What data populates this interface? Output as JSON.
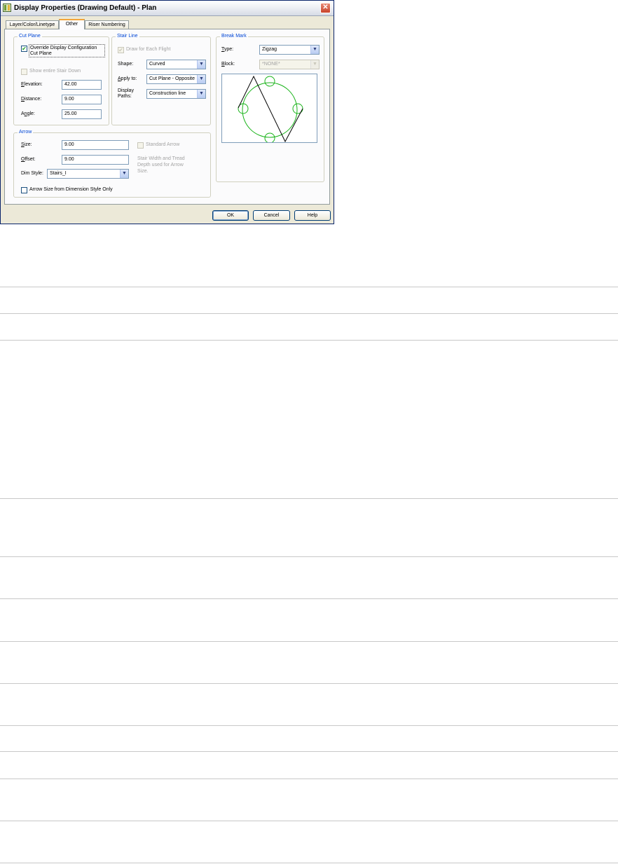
{
  "window": {
    "title": "Display Properties (Drawing Default) - Plan",
    "close_glyph": "✕"
  },
  "tabs": [
    {
      "label": "Layer/Color/Linetype",
      "active": false
    },
    {
      "label": "Other",
      "active": true
    },
    {
      "label": "Riser Numbering",
      "active": false
    }
  ],
  "cut_plane": {
    "legend": "Cut Plane",
    "override_label_line1": "Override Display Configuration",
    "override_label_line2": "Cut Plane",
    "override_checked": true,
    "show_entire_label": "Show entire Stair Down",
    "show_entire_checked": false,
    "elevation_label": "Elevation:",
    "elevation_value": "42.00",
    "distance_label": "Distance:",
    "distance_value": "9.00",
    "angle_label": "Angle:",
    "angle_value": "25.00"
  },
  "stair_line": {
    "legend": "Stair Line",
    "draw_each_label": "Draw for Each Flight",
    "draw_each_checked": true,
    "shape_label": "Shape:",
    "shape_value": "Curved",
    "apply_to_label": "Apply to:",
    "apply_to_value": "Cut Plane - Opposite",
    "display_paths_label_line1": "Display",
    "display_paths_label_line2": "Paths:",
    "display_paths_value": "Construction line"
  },
  "break_mark": {
    "legend": "Break Mark",
    "type_label": "Type:",
    "type_value": "Zigzag",
    "block_label": "Block:",
    "block_value": "*NONE*"
  },
  "arrow": {
    "legend": "Arrow",
    "size_label": "Size:",
    "size_value": "9.00",
    "offset_label": "Offset:",
    "offset_value": "9.00",
    "dim_style_label": "Dim Style:",
    "dim_style_value": "Stairs_I",
    "standard_arrow_label": "Standard Arrow",
    "standard_arrow_checked": false,
    "note_line1": "Stair Width and Tread",
    "note_line2": "Depth used for Arrow",
    "note_line3": "Size.",
    "arrow_size_from_dim_label": "Arrow Size from Dimension Style Only",
    "arrow_size_from_dim_checked": false
  },
  "buttons": {
    "ok": "OK",
    "cancel": "Cancel",
    "help": "Help"
  },
  "colors": {
    "legend_blue": "#0046d5",
    "preview_green": "#19b319",
    "title_close_red": "#c7432b"
  },
  "icons": [
    "app-icon",
    "close-icon",
    "combo-arrow-icon",
    "checkmark-icon"
  ]
}
